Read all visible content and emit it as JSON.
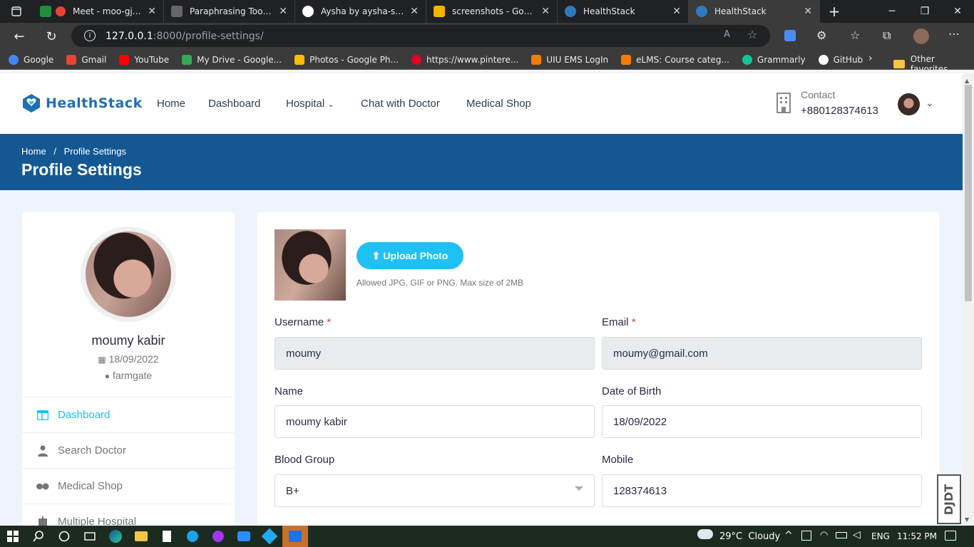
{
  "browser": {
    "tabs": [
      {
        "title": "Meet - moo-gjaa",
        "color": "#1e8e3e"
      },
      {
        "title": "Paraphrasing Tool | Qu",
        "color": "#555"
      },
      {
        "title": "Aysha by aysha-siddik",
        "color": "#fff"
      },
      {
        "title": "screenshots - Google",
        "color": "#f4b400"
      },
      {
        "title": "HealthStack",
        "color": "#2f7bbf"
      },
      {
        "title": "HealthStack",
        "color": "#2f7bbf"
      }
    ],
    "url_host": "127.0.0.1",
    "url_path": ":8000/profile-settings/",
    "bookmarks": [
      {
        "label": "Google",
        "color": "#4285f4"
      },
      {
        "label": "Gmail",
        "color": "#ea4335"
      },
      {
        "label": "YouTube",
        "color": "#ff0000"
      },
      {
        "label": "My Drive - Google...",
        "color": "#34a853"
      },
      {
        "label": "Photos - Google Ph...",
        "color": "#fbbc05"
      },
      {
        "label": "https://www.pintere...",
        "color": "#e60023"
      },
      {
        "label": "UIU EMS LogIn",
        "color": "#f57c00"
      },
      {
        "label": "eLMS: Course categ...",
        "color": "#f57c00"
      },
      {
        "label": "Grammarly",
        "color": "#15c39a"
      },
      {
        "label": "GitHub",
        "color": "#ffffff"
      }
    ],
    "other_favorites": "Other favorites"
  },
  "site": {
    "brand": "HealthStack",
    "nav": {
      "home": "Home",
      "dashboard": "Dashboard",
      "hospital": "Hospital",
      "chat": "Chat with Doctor",
      "shop": "Medical Shop"
    },
    "contact_label": "Contact",
    "contact_phone": "+880128374613"
  },
  "hero": {
    "crumb_home": "Home",
    "crumb_sep": "/",
    "crumb_current": "Profile Settings",
    "title": "Profile Settings"
  },
  "sidebar": {
    "name": "moumy kabir",
    "dob": "18/09/2022",
    "location": "farmgate",
    "menu": [
      {
        "label": "Dashboard"
      },
      {
        "label": "Search Doctor"
      },
      {
        "label": "Medical Shop"
      },
      {
        "label": "Multiple Hospital"
      }
    ]
  },
  "form": {
    "upload_button": "Upload Photo",
    "upload_hint": "Allowed JPG, GIF or PNG. Max size of 2MB",
    "username_label": "Username",
    "username_value": "moumy",
    "email_label": "Email",
    "email_value": "moumy@gmail.com",
    "name_label": "Name",
    "name_value": "moumy kabir",
    "dob_label": "Date of Birth",
    "dob_value": "18/09/2022",
    "blood_label": "Blood Group",
    "blood_value": "B+",
    "mobile_label": "Mobile",
    "mobile_value": "128374613",
    "required_mark": "*"
  },
  "taskbar": {
    "weather": "29°C  Cloudy",
    "lang": "ENG",
    "time": "11:52 PM"
  },
  "colors": {
    "brand_blue": "#135892",
    "accent_cyan": "#20c0f3"
  }
}
